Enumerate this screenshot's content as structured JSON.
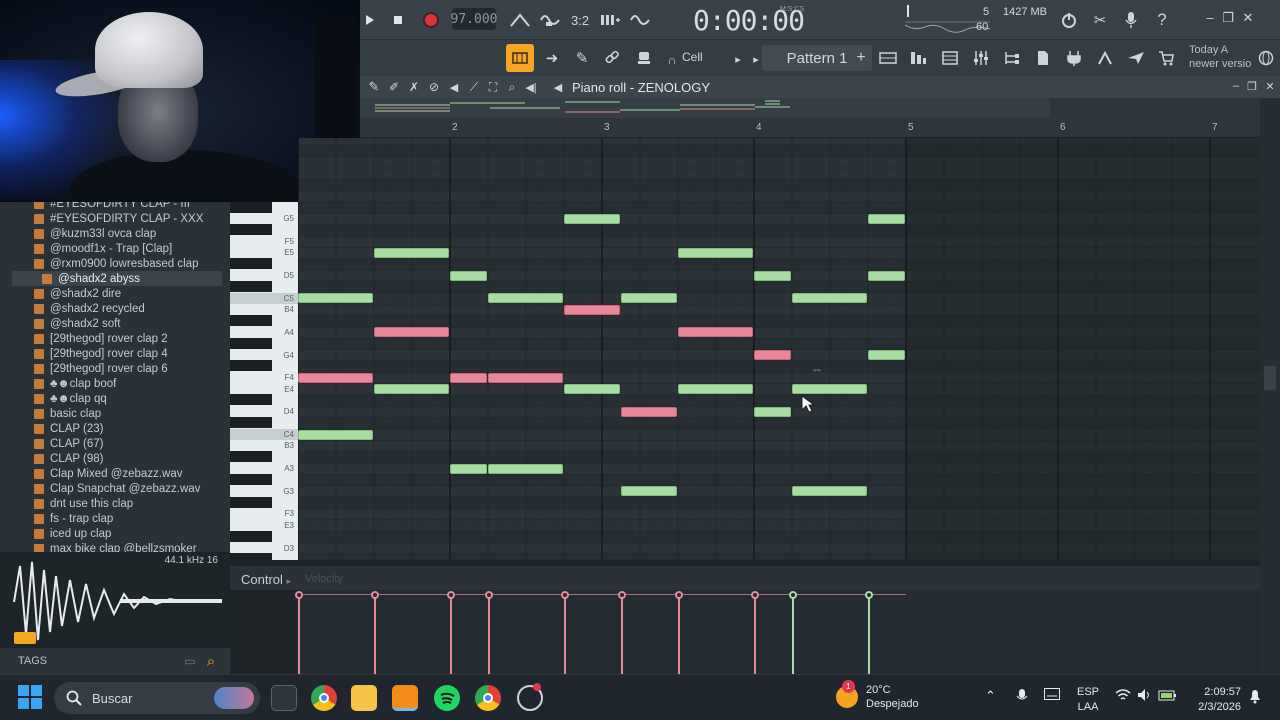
{
  "toolbar": {
    "tempo": "97.000",
    "time": "0:00:00",
    "time_unit": "M:S:CS",
    "cpu": "5",
    "poly": "60",
    "memory": "1427 MB",
    "mode_label": "Cell",
    "pattern": "Pattern 1",
    "news_line1": "Today  A",
    "news_line2": "newer versio"
  },
  "piano_roll": {
    "title": "Piano roll - ZENOLOGY",
    "bars": [
      "2",
      "3",
      "4",
      "5",
      "6",
      "7"
    ],
    "control_label": "Control",
    "velocity_label": "Velocity",
    "keys": [
      "G5",
      "F5",
      "E5",
      "D5",
      "C5",
      "B4",
      "A4",
      "G4",
      "F4",
      "E4",
      "D4",
      "C4",
      "B3",
      "A3",
      "G3",
      "F3",
      "E3",
      "D3"
    ],
    "notes": [
      {
        "pitch": "C5",
        "start": 1.0,
        "len": 0.5,
        "color": "green"
      },
      {
        "pitch": "F4",
        "start": 1.0,
        "len": 0.5,
        "color": "red"
      },
      {
        "pitch": "C4",
        "start": 1.0,
        "len": 0.5,
        "color": "green"
      },
      {
        "pitch": "E5",
        "start": 1.5,
        "len": 0.5,
        "color": "green"
      },
      {
        "pitch": "A4",
        "start": 1.5,
        "len": 0.5,
        "color": "red"
      },
      {
        "pitch": "E4",
        "start": 1.5,
        "len": 0.5,
        "color": "green"
      },
      {
        "pitch": "D5",
        "start": 2.0,
        "len": 0.25,
        "color": "green"
      },
      {
        "pitch": "F4",
        "start": 2.0,
        "len": 0.25,
        "color": "red"
      },
      {
        "pitch": "A3",
        "start": 2.0,
        "len": 0.25,
        "color": "green"
      },
      {
        "pitch": "C5",
        "start": 2.25,
        "len": 0.5,
        "color": "green"
      },
      {
        "pitch": "F4",
        "start": 2.25,
        "len": 0.5,
        "color": "red"
      },
      {
        "pitch": "A3",
        "start": 2.25,
        "len": 0.5,
        "color": "green"
      },
      {
        "pitch": "G5",
        "start": 2.75,
        "len": 0.375,
        "color": "green"
      },
      {
        "pitch": "B4",
        "start": 2.75,
        "len": 0.375,
        "color": "red"
      },
      {
        "pitch": "E4",
        "start": 2.75,
        "len": 0.375,
        "color": "green"
      },
      {
        "pitch": "C5",
        "start": 3.125,
        "len": 0.375,
        "color": "green"
      },
      {
        "pitch": "D4",
        "start": 3.125,
        "len": 0.375,
        "color": "red"
      },
      {
        "pitch": "G3",
        "start": 3.125,
        "len": 0.375,
        "color": "green"
      },
      {
        "pitch": "E5",
        "start": 3.5,
        "len": 0.5,
        "color": "green"
      },
      {
        "pitch": "A4",
        "start": 3.5,
        "len": 0.5,
        "color": "red"
      },
      {
        "pitch": "E4",
        "start": 3.5,
        "len": 0.5,
        "color": "green"
      },
      {
        "pitch": "D5",
        "start": 4.0,
        "len": 0.25,
        "color": "green"
      },
      {
        "pitch": "G4",
        "start": 4.0,
        "len": 0.25,
        "color": "red"
      },
      {
        "pitch": "D4",
        "start": 4.0,
        "len": 0.25,
        "color": "green"
      },
      {
        "pitch": "C5",
        "start": 4.25,
        "len": 0.5,
        "color": "green"
      },
      {
        "pitch": "E4",
        "start": 4.25,
        "len": 0.5,
        "color": "green"
      },
      {
        "pitch": "G3",
        "start": 4.25,
        "len": 0.5,
        "color": "green"
      },
      {
        "pitch": "G5",
        "start": 4.75,
        "len": 0.25,
        "color": "green"
      },
      {
        "pitch": "D5",
        "start": 4.75,
        "len": 0.25,
        "color": "green"
      },
      {
        "pitch": "G4",
        "start": 4.75,
        "len": 0.25,
        "color": "green"
      }
    ],
    "velocities": [
      {
        "start": 1.0,
        "color": "red"
      },
      {
        "start": 1.5,
        "color": "red"
      },
      {
        "start": 2.0,
        "color": "red"
      },
      {
        "start": 2.25,
        "color": "red"
      },
      {
        "start": 2.75,
        "color": "red"
      },
      {
        "start": 3.125,
        "color": "red"
      },
      {
        "start": 3.5,
        "color": "red"
      },
      {
        "start": 4.0,
        "color": "red"
      },
      {
        "start": 4.25,
        "color": "green"
      },
      {
        "start": 4.75,
        "color": "green"
      }
    ]
  },
  "browser": {
    "items": [
      "#EYESOFDIRTY CLAP - III",
      "#EYESOFDIRTY CLAP - XXX",
      "@kuzm33l ovca clap",
      "@moodf1x - Trap [Clap]",
      "@rxm0900 lowresbased clap",
      "@shadx2 abyss",
      "@shadx2 dire",
      "@shadx2 recycled",
      "@shadx2 soft",
      "[29thegod] rover clap 2",
      "[29thegod] rover clap 4",
      "[29thegod] rover clap 6",
      "♣☻clap boof",
      "♣☻clap qq",
      "basic clap",
      "CLAP (23)",
      "CLAP (67)",
      "CLAP (98)",
      "Clap Mixed @zebazz.wav",
      "Clap Snapchat @zebazz.wav",
      "dnt use this clap",
      "fs - trap clap",
      "iced up clap",
      "max bike clap @bellzsmoker"
    ],
    "selected_index": 5,
    "sample_info": "44.1 kHz 16",
    "tags_label": "TAGS"
  },
  "taskbar": {
    "search_placeholder": "Buscar",
    "temperature": "20°C",
    "weather": "Despejado",
    "weather_badge": "1",
    "lang_line1": "ESP",
    "lang_line2": "LAA",
    "clock_time": "2:09:57",
    "clock_date": "2/3/2026"
  },
  "colors": {
    "note_green": "#a8dca4",
    "note_red": "#e8879a",
    "accent_orange": "#f5a623",
    "record_red": "#d8353b"
  }
}
